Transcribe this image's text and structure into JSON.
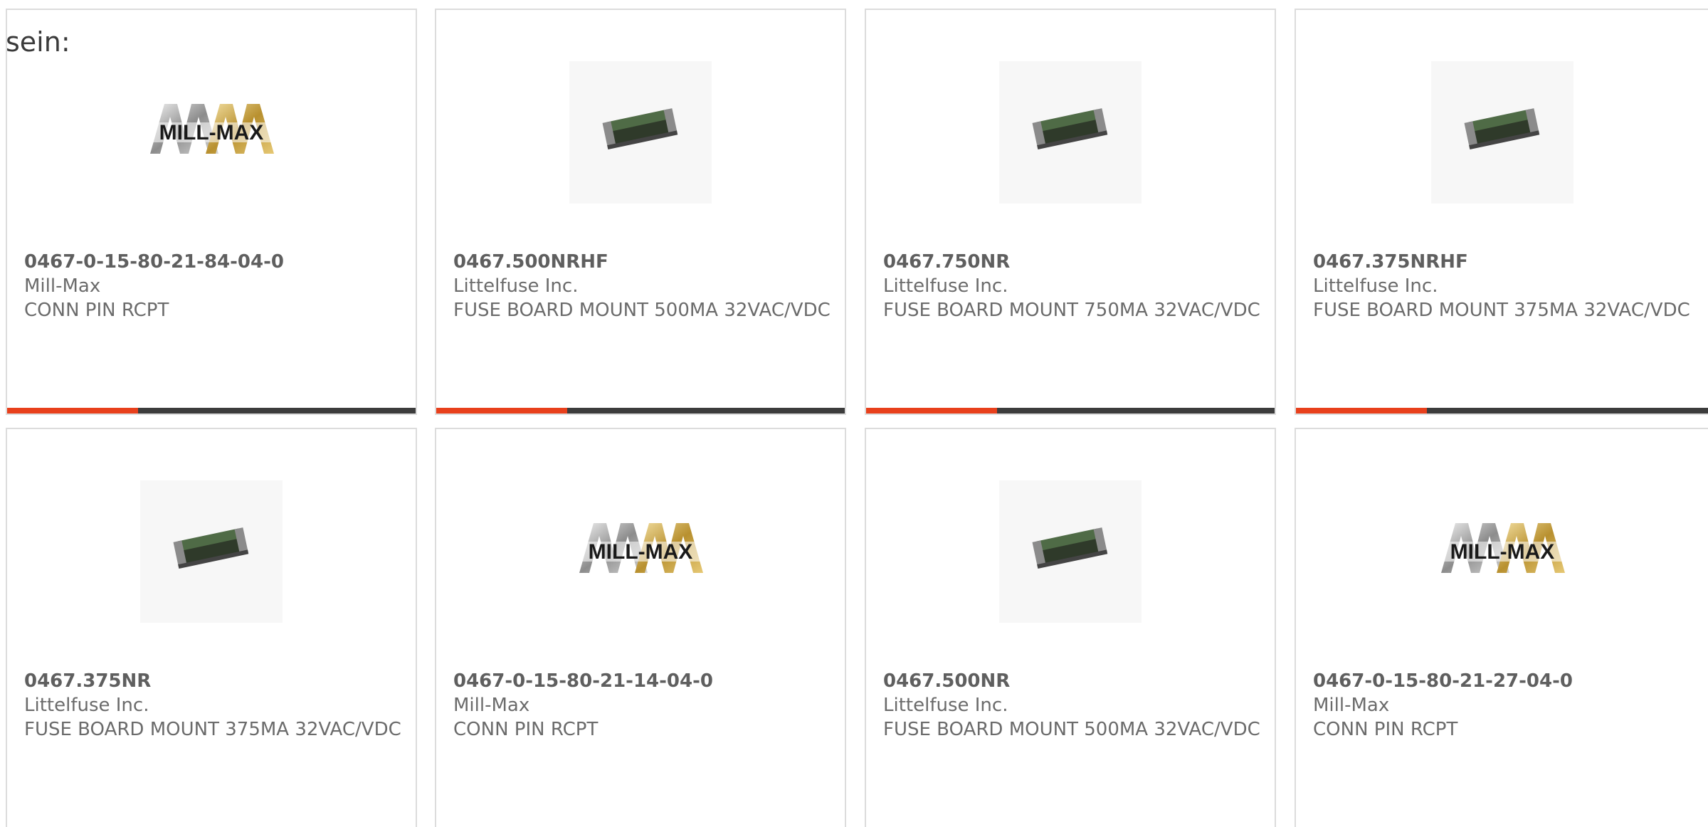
{
  "intro": {
    "text": "sein:"
  },
  "colors": {
    "accent": "#e8401c",
    "bar": "#3c3c3c",
    "card_border": "#dcdcdc",
    "text": "#6b6b6b"
  },
  "products": [
    {
      "part_number": "0467-0-15-80-21-84-04-0",
      "manufacturer": "Mill-Max",
      "description": "CONN PIN RCPT",
      "image": "mill-max-logo"
    },
    {
      "part_number": "0467.500NRHF",
      "manufacturer": "Littelfuse Inc.",
      "description": "FUSE BOARD MOUNT 500MA 32VAC/VDC",
      "image": "smd-fuse"
    },
    {
      "part_number": "0467.750NR",
      "manufacturer": "Littelfuse Inc.",
      "description": "FUSE BOARD MOUNT 750MA 32VAC/VDC",
      "image": "smd-fuse"
    },
    {
      "part_number": "0467.375NRHF",
      "manufacturer": "Littelfuse Inc.",
      "description": "FUSE BOARD MOUNT 375MA 32VAC/VDC",
      "image": "smd-fuse"
    },
    {
      "part_number": "0467.375NR",
      "manufacturer": "Littelfuse Inc.",
      "description": "FUSE BOARD MOUNT 375MA 32VAC/VDC",
      "image": "smd-fuse"
    },
    {
      "part_number": "0467-0-15-80-21-14-04-0",
      "manufacturer": "Mill-Max",
      "description": "CONN PIN RCPT",
      "image": "mill-max-logo"
    },
    {
      "part_number": "0467.500NR",
      "manufacturer": "Littelfuse Inc.",
      "description": "FUSE BOARD MOUNT 500MA 32VAC/VDC",
      "image": "smd-fuse"
    },
    {
      "part_number": "0467-0-15-80-21-27-04-0",
      "manufacturer": "Mill-Max",
      "description": "CONN PIN RCPT",
      "image": "mill-max-logo"
    }
  ],
  "logo_text": "MILL-MAX"
}
